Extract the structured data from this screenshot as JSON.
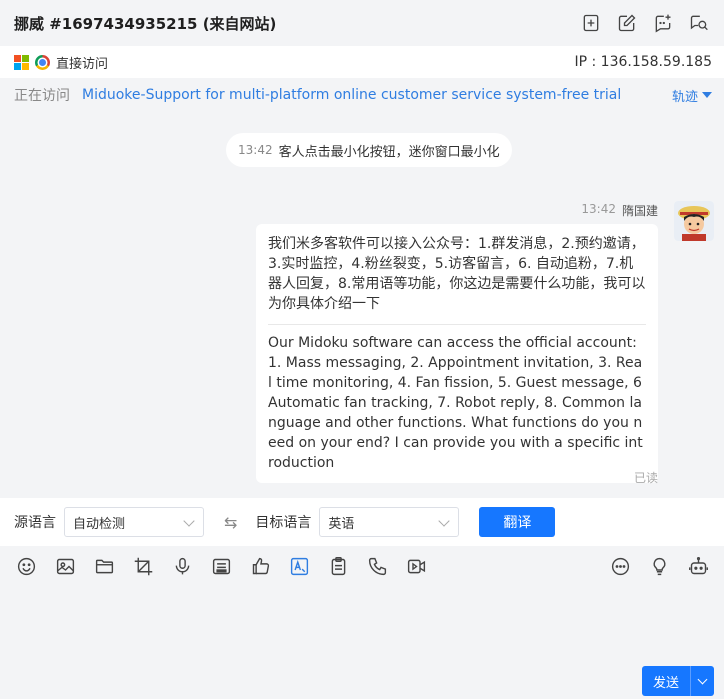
{
  "header": {
    "title": "挪威 #1697434935215 (来自网站)",
    "icons": [
      "add-note-icon",
      "edit-icon",
      "chat-add-icon",
      "search-chat-icon"
    ]
  },
  "visitor": {
    "access_type": "直接访问",
    "ip": "IP : 136.158.59.185",
    "visiting_label": "正在访问",
    "visiting_page": "Miduoke-Support for multi-platform online customer service system-free trial",
    "track_label": "轨迹"
  },
  "chat": {
    "system_message": {
      "time": "13:42",
      "text": "客人点击最小化按钮，迷你窗口最小化"
    },
    "message": {
      "time": "13:42",
      "sender": "隋国建",
      "chinese": "我们米多客软件可以接入公众号：1.群发消息，2.预约邀请，3.实时监控，4.粉丝裂变，5.访客留言，6. 自动追粉，7.机器人回复，8.常用语等功能，你这边是需要什么功能，我可以为你具体介绍一下",
      "english": "Our Midoku software can access the official account: 1. Mass messaging, 2. Appointment invitation, 3. Real time monitoring, 4. Fan fission, 5. Guest message, 6 Automatic fan tracking, 7. Robot reply, 8. Common language and other functions. What functions do you need on your end? I can provide you with a specific introduction",
      "status": "已读"
    }
  },
  "translate": {
    "source_label": "源语言",
    "source_value": "自动检测",
    "target_label": "目标语言",
    "target_value": "英语",
    "button": "翻译"
  },
  "input": {
    "send_label": "发送"
  },
  "colors": {
    "accent": "#1677ff",
    "link": "#2f7de1"
  }
}
